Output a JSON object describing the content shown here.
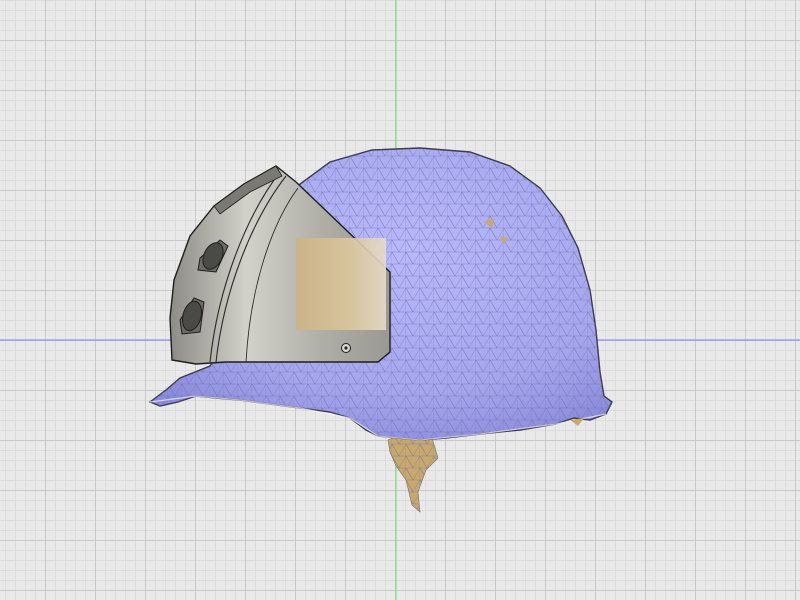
{
  "viewport": {
    "background_color": "#e9e9e9",
    "grid_minor_color": "#dcdcdc",
    "grid_major_color": "#c9c9c9",
    "x_axis_color": "#7b7bff",
    "y_axis_color": "#6ee06e"
  },
  "model": {
    "helmet_mesh_color": "#aaaaf0",
    "wireframe_color": "#6f6fa8",
    "bracket_color": "#a6a59c",
    "lens_color": "#d5b98a",
    "inner_shell_color": "#c8a96b"
  }
}
